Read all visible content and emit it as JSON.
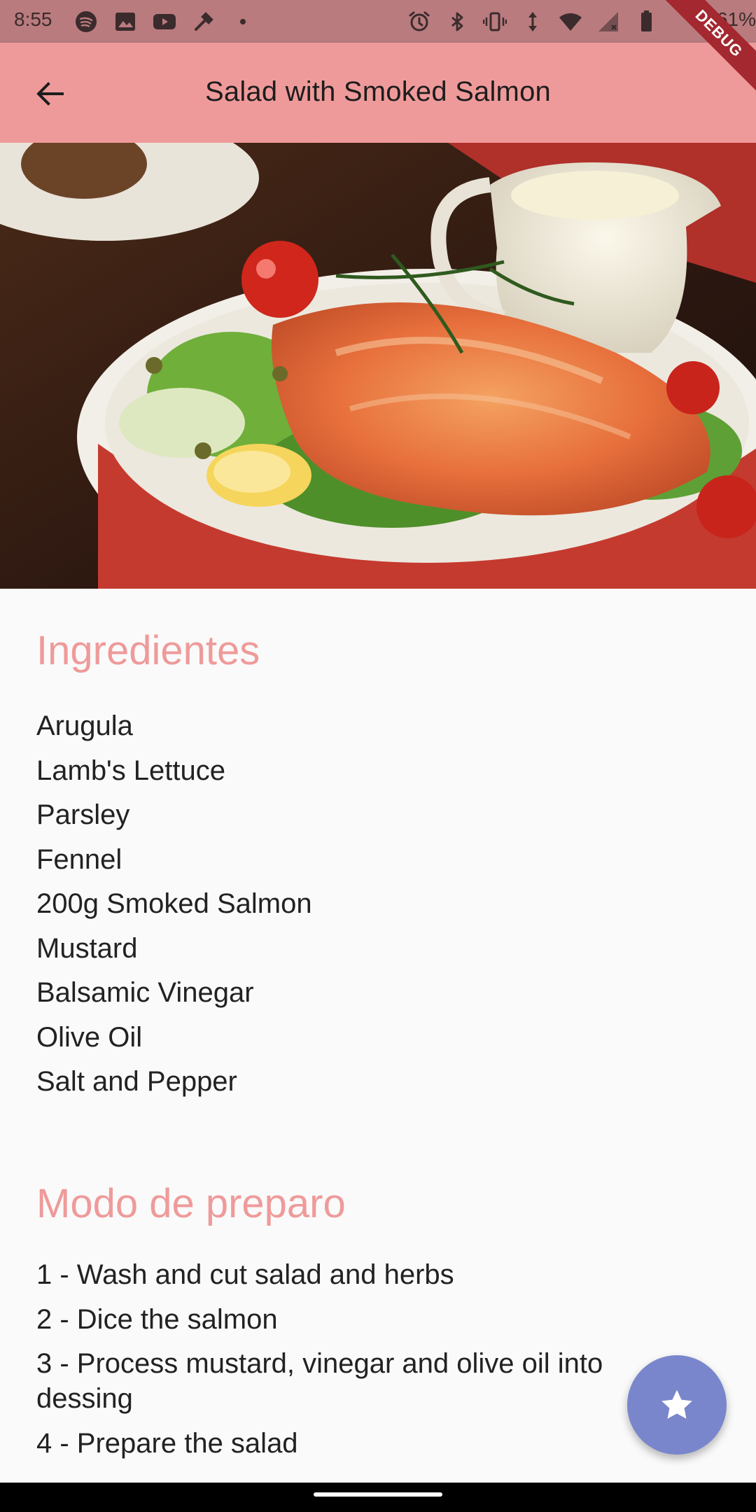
{
  "status_bar": {
    "time": "8:55",
    "battery": "61%",
    "left_icons": [
      "spotify-icon",
      "image-icon",
      "youtube-icon",
      "tools-icon",
      "dot-icon"
    ],
    "right_icons": [
      "alarm-icon",
      "bluetooth-icon",
      "vibrate-icon",
      "data-arrows-icon",
      "wifi-icon",
      "signal-icon",
      "battery-icon"
    ]
  },
  "app_bar": {
    "title": "Salad with Smoked Salmon",
    "back_icon": "arrow-back-icon",
    "debug_label": "DEBUG",
    "color": "#EF9A9A"
  },
  "ingredients": {
    "title": "Ingredientes",
    "items": [
      "Arugula",
      "Lamb's Lettuce",
      "Parsley",
      "Fennel",
      "200g Smoked Salmon",
      "Mustard",
      "Balsamic Vinegar",
      "Olive Oil",
      "Salt and Pepper"
    ]
  },
  "preparation": {
    "title": "Modo de preparo",
    "steps": [
      "1 - Wash and cut salad and herbs",
      "2 - Dice the salmon",
      "3 - Process mustard, vinegar and olive oil into dessing",
      "4 - Prepare the salad"
    ]
  },
  "fab": {
    "icon": "star-icon",
    "color": "#7986CB"
  },
  "accent_color": "#EF9A9A"
}
